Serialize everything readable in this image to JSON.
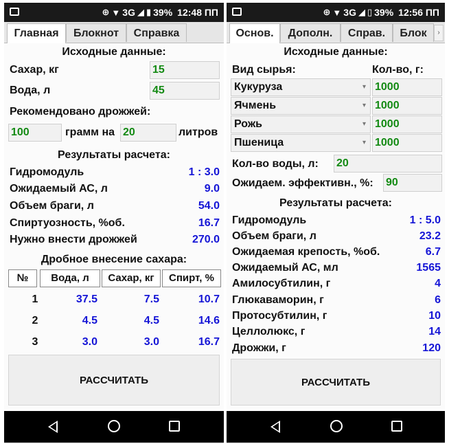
{
  "left": {
    "status": {
      "signal": "3G",
      "battery": "39%",
      "time": "12:48 ПП"
    },
    "tabs": [
      "Главная",
      "Блокнот",
      "Справка"
    ],
    "input_heading": "Исходные данные:",
    "sugar_label": "Сахар, кг",
    "sugar_value": "15",
    "water_label": "Вода, л",
    "water_value": "45",
    "yeast_heading": "Рекомендовано дрожжей:",
    "yeast_grams": "100",
    "grams_per_label": "грамм на",
    "yeast_liters": "20",
    "liters_label": "литров",
    "results_heading": "Результаты расчета:",
    "results": [
      {
        "label": "Гидромодуль",
        "value": "1 : 3.0"
      },
      {
        "label": "Ожидаемый АС, л",
        "value": "9.0"
      },
      {
        "label": "Объем браги, л",
        "value": "54.0"
      },
      {
        "label": "Спиртуозность, %об.",
        "value": "16.7"
      },
      {
        "label": "Нужно внести дрожжей",
        "value": "270.0"
      }
    ],
    "fraction_heading": "Дробное внесение сахара:",
    "table_headers": [
      "№",
      "Вода, л",
      "Сахар, кг",
      "Спирт, %"
    ],
    "table_rows": [
      [
        "1",
        "37.5",
        "7.5",
        "10.7"
      ],
      [
        "2",
        "4.5",
        "4.5",
        "14.6"
      ],
      [
        "3",
        "3.0",
        "3.0",
        "16.7"
      ]
    ],
    "calc_button": "РАССЧИТАТЬ"
  },
  "right": {
    "status": {
      "signal": "3G",
      "battery": "39%",
      "time": "12:56 ПП"
    },
    "tabs": [
      "Основ.",
      "Дополн.",
      "Справ.",
      "Блок"
    ],
    "input_heading": "Исходные данные:",
    "raw_label": "Вид сырья:",
    "qty_label": "Кол-во, г:",
    "raw_rows": [
      {
        "name": "Кукуруза",
        "qty": "1000"
      },
      {
        "name": "Ячмень",
        "qty": "1000"
      },
      {
        "name": "Рожь",
        "qty": "1000"
      },
      {
        "name": "Пшеница",
        "qty": "1000"
      }
    ],
    "water_label": "Кол-во воды, л:",
    "water_value": "20",
    "eff_label": "Ожидаем. эффективн., %:",
    "eff_value": "90",
    "results_heading": "Результаты расчета:",
    "results": [
      {
        "label": "Гидромодуль",
        "value": "1 : 5.0"
      },
      {
        "label": "Объем браги, л",
        "value": "23.2"
      },
      {
        "label": "Ожидаемая  крепость, %об.",
        "value": "6.7"
      },
      {
        "label": "Ожидаемый АС, мл",
        "value": "1565"
      },
      {
        "label": "Амилосубтилин, г",
        "value": "4"
      },
      {
        "label": "Глюкаваморин, г",
        "value": "6"
      },
      {
        "label": "Протосубтилин, г",
        "value": "10"
      },
      {
        "label": "Целлолюкс, г",
        "value": "14"
      },
      {
        "label": "Дрожжи, г",
        "value": "120"
      }
    ],
    "calc_button": "РАССЧИТАТЬ"
  }
}
